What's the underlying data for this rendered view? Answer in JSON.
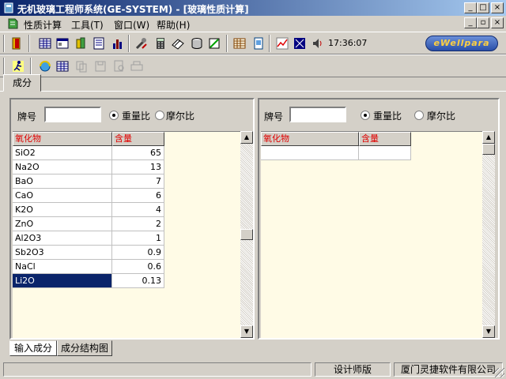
{
  "window": {
    "title": "无机玻璃工程师系统(GE-SYSTEM) - [玻璃性质计算]",
    "minimize": "_",
    "maximize": "□",
    "close": "×",
    "mdi_minimize": "_",
    "mdi_restore": "▫",
    "mdi_close": "×"
  },
  "menu": {
    "items": [
      {
        "label": "性质计算"
      },
      {
        "label": "工具(T)"
      },
      {
        "label": "窗口(W)"
      },
      {
        "label": "帮助(H)"
      }
    ]
  },
  "toolbar": {
    "clock": "17:36:07",
    "brand": "eWellpara"
  },
  "tabs": {
    "top": "成分"
  },
  "left_pane": {
    "brand_label": "牌号",
    "brand_value": "",
    "radio_weight": "重量比",
    "radio_mole": "摩尔比",
    "radio_selected": "重量比",
    "col_oxide": "氧化物",
    "col_amount": "含量",
    "rows": [
      {
        "oxide": "SiO2",
        "amount": "65"
      },
      {
        "oxide": "Na2O",
        "amount": "13"
      },
      {
        "oxide": "BaO",
        "amount": "7"
      },
      {
        "oxide": "CaO",
        "amount": "6"
      },
      {
        "oxide": "K2O",
        "amount": "4"
      },
      {
        "oxide": "ZnO",
        "amount": "2"
      },
      {
        "oxide": "Al2O3",
        "amount": "1"
      },
      {
        "oxide": "Sb2O3",
        "amount": "0.9"
      },
      {
        "oxide": "NaCl",
        "amount": "0.6"
      },
      {
        "oxide": "Li2O",
        "amount": "0.13"
      }
    ],
    "selected_row": "Li2O"
  },
  "right_pane": {
    "brand_label": "牌号",
    "brand_value": "",
    "radio_weight": "重量比",
    "radio_mole": "摩尔比",
    "radio_selected": "重量比",
    "col_oxide": "氧化物",
    "col_amount": "含量"
  },
  "bottom_tabs": [
    {
      "label": "输入成分"
    },
    {
      "label": "成分结构图"
    }
  ],
  "statusbar": {
    "edition": "设计师版",
    "company": "厦门灵捷软件有限公司"
  },
  "colors": {
    "title_start": "#0a246a",
    "title_end": "#a6caf0",
    "grid_bg": "#fffbe6",
    "header_text": "#e00000",
    "selection": "#0a246a"
  }
}
